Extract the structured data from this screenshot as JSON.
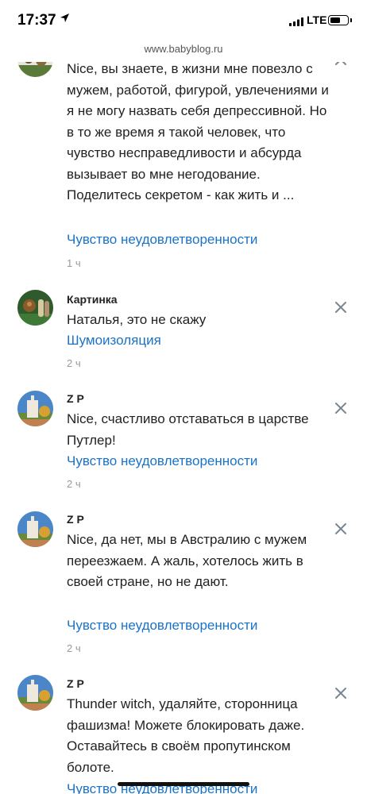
{
  "status": {
    "time": "17:37",
    "network": "LTE"
  },
  "browser": {
    "url": "www.babyblog.ru"
  },
  "comments": [
    {
      "author": "",
      "text": "Nice, вы знаете, в жизни мне повезло с мужем, работой, фигурой, увлечениями и я не могу назвать себя депрессивной. Но в то же время я такой человек, что чувство несправедливости и абсурда вызывает во мне негодование. Поделитесь секретом - как жить и ...",
      "link": "Чувство неудовлетворенности",
      "time": "1 ч"
    },
    {
      "author": "Картинка",
      "text": "Наталья, это не скажу",
      "link": "Шумоизоляция",
      "time": "2 ч"
    },
    {
      "author": "Z P",
      "text": "Nice, счастливо отставаться в царстве Путлер!",
      "link": "Чувство неудовлетворенности",
      "time": "2 ч"
    },
    {
      "author": "Z P",
      "text": "Nice, да нет, мы в Австралию с мужем переезжаем. А жаль, хотелось жить в своей стране, но не дают.",
      "link": "Чувство неудовлетворенности",
      "time": "2 ч"
    },
    {
      "author": "Z P",
      "text": "Thunder witch, удаляйте, сторонница фашизма! Можете блокировать даже. Оставайтесь в своём пропутинском болоте.",
      "link": "Чувство неудовлетворенности",
      "time": ""
    }
  ],
  "icons": {
    "close": "close-icon",
    "location": "location-arrow-icon",
    "signal": "signal-bars-icon",
    "battery": "battery-icon"
  },
  "colors": {
    "link": "#1a73c9",
    "close": "#7a8793",
    "meta": "#999999"
  }
}
